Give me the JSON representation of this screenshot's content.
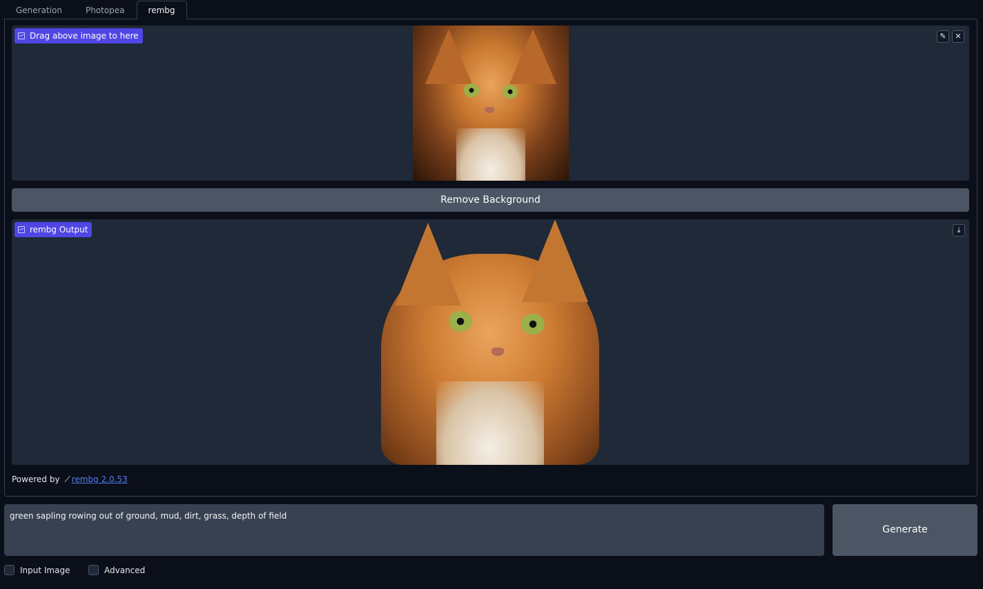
{
  "tabs": [
    {
      "label": "Generation"
    },
    {
      "label": "Photopea"
    },
    {
      "label": "rembg"
    }
  ],
  "input_image": {
    "label": "Drag above image to here",
    "edit_icon": "pencil-icon",
    "clear_icon": "close-icon"
  },
  "remove_button": {
    "label": "Remove Background"
  },
  "output_image": {
    "label": "rembg Output",
    "download_icon": "download-icon"
  },
  "footer": {
    "powered_by": "Powered by",
    "wand_icon": "magic-wand-icon",
    "link_text": "rembg 2.0.53"
  },
  "prompt": {
    "value": "green sapling rowing out of ground, mud, dirt, grass, depth of field"
  },
  "generate_button": {
    "label": "Generate"
  },
  "options": [
    {
      "label": "Input Image",
      "checked": false
    },
    {
      "label": "Advanced",
      "checked": false
    }
  ],
  "colors": {
    "background": "#0b0f19",
    "panel": "#1f2937",
    "accent": "#4f46e5",
    "button": "#4b5563",
    "link": "#4f7ff0"
  }
}
